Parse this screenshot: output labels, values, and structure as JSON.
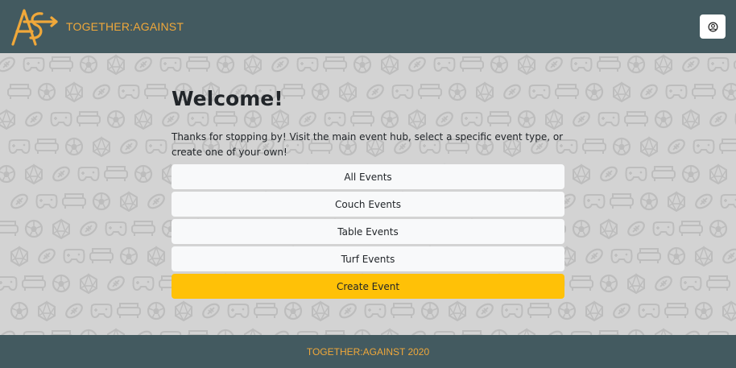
{
  "header": {
    "brand_name": "TOGETHER:AGAINST",
    "logo_icon": "together-against-logo",
    "user_icon": "user-circle-icon",
    "colors": {
      "bar": "#435a60",
      "brand": "#f0a83a"
    }
  },
  "main": {
    "title": "Welcome!",
    "intro": "Thanks for stopping by! Visit the main event hub, select a specific event type, or create one of your own!",
    "buttons": [
      {
        "label": "All Events"
      },
      {
        "label": "Couch Events"
      },
      {
        "label": "Table Events"
      },
      {
        "label": "Turf Events"
      },
      {
        "label": "Create Event"
      }
    ],
    "colors": {
      "background": "#d3d3d3",
      "button": "#f8f9fa",
      "primary": "#ffc107"
    },
    "background_icons": [
      "football-icon",
      "gamepad-icon",
      "couch-icon",
      "soccer-ball-icon",
      "d20-dice-icon"
    ]
  },
  "footer": {
    "text": "TOGETHER:AGAINST 2020"
  }
}
